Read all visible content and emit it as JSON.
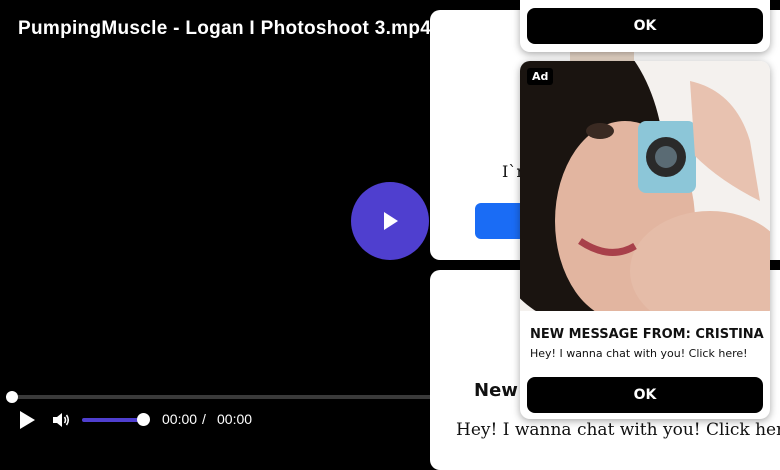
{
  "player": {
    "title": "PumpingMuscle - Logan I Photoshoot 3.mp4",
    "current_time": "00:00",
    "separator": "/",
    "duration": "00:00",
    "progress": 0,
    "volume": 1.0,
    "accent_color": "#4f3fcf"
  },
  "background_cards": {
    "card_a_text": "I`m",
    "card_b_heading": "New",
    "card_b_text": "Hey! I wanna chat with you! Click here!"
  },
  "ad_top": {
    "ok_label": "OK"
  },
  "ad": {
    "badge": "Ad",
    "headline": "NEW MESSAGE FROM: CRISTINA",
    "subtext": "Hey! I wanna chat with you! Click here!",
    "ok_label": "OK"
  }
}
